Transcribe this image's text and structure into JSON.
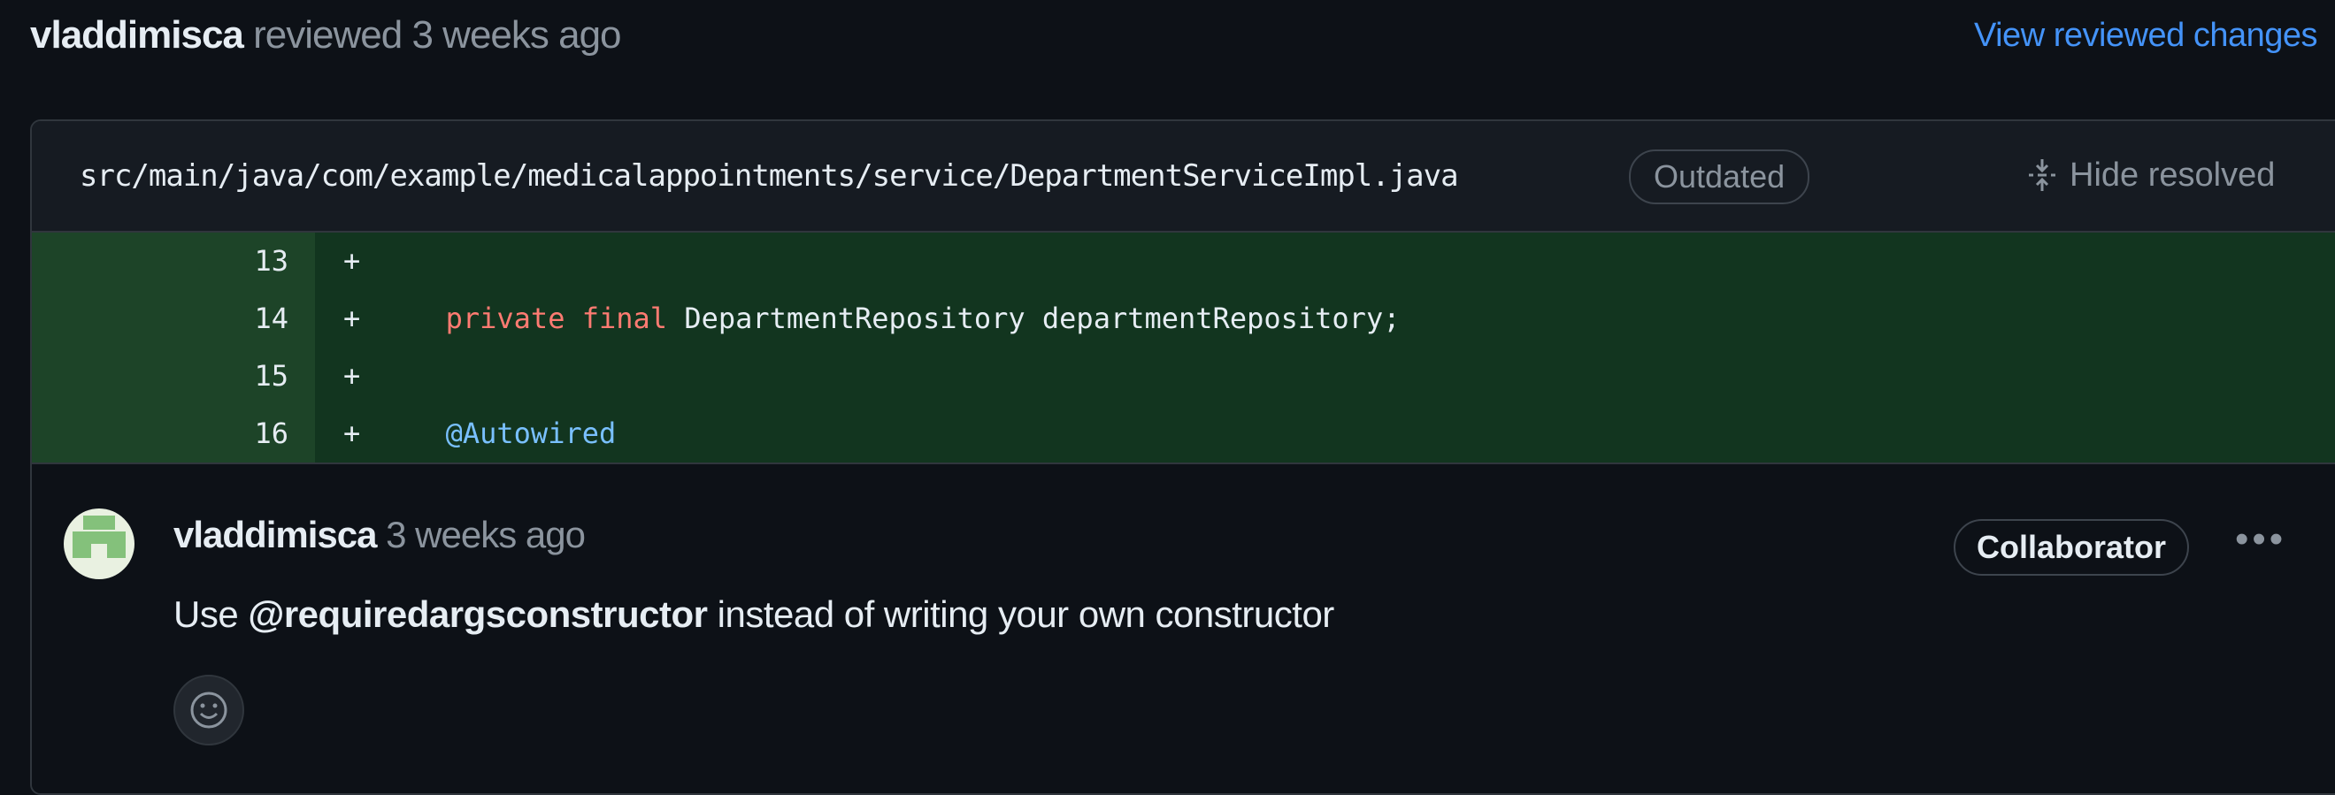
{
  "review_header": {
    "user": "vladdimisca",
    "action": "reviewed",
    "time": "3 weeks ago",
    "view_link": "View reviewed changes"
  },
  "file": {
    "path": "src/main/java/com/example/medicalappointments/service/DepartmentServiceImpl.java",
    "badge": "Outdated",
    "hide_resolved": "Hide resolved"
  },
  "diff_lines": [
    {
      "num": "13",
      "marker": "+",
      "code": ""
    },
    {
      "num": "14",
      "marker": "+",
      "kw1": "private",
      "kw2": "final",
      "rest": "DepartmentRepository departmentRepository;"
    },
    {
      "num": "15",
      "marker": "+",
      "code": ""
    },
    {
      "num": "16",
      "marker": "+",
      "annotation": "@Autowired"
    }
  ],
  "comment": {
    "user": "vladdimisca",
    "time": "3 weeks ago",
    "role_badge": "Collaborator",
    "menu": "•••",
    "body_prefix": "Use",
    "mention": "@requiredargsconstructor",
    "body_suffix": "instead of writing your own constructor"
  },
  "icons": {
    "hide_resolved": "unfold-icon",
    "reaction": "smiley-icon",
    "menu": "kebab-horizontal-icon"
  }
}
